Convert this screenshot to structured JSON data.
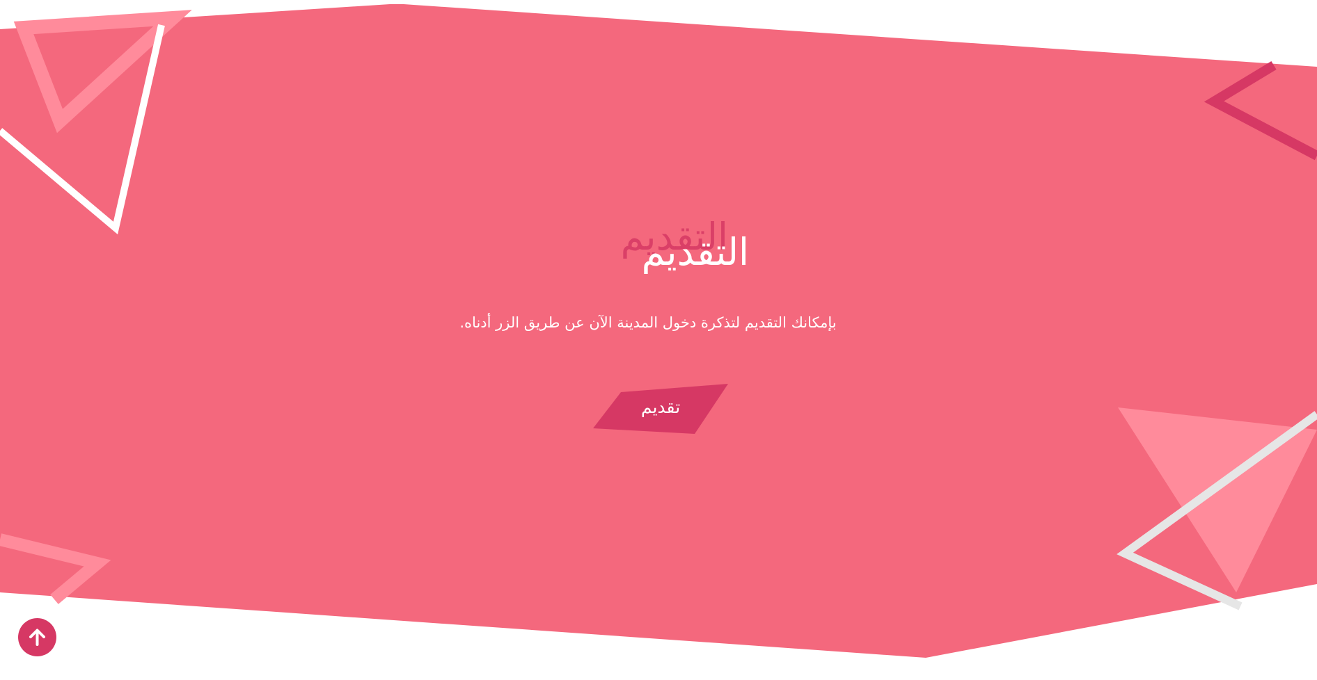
{
  "hero": {
    "title": "التقديم",
    "title_shadow": "التقديم",
    "description": "بإمكانك التقديم لتذكرة دخول المدينة الآن عن طريق الزر أدناه.",
    "cta_label": "تقديم"
  },
  "controls": {
    "scroll_top_icon": "arrow-up-icon"
  },
  "colors": {
    "background_panel": "#f4687d",
    "accent": "#d63864",
    "light_shape": "#ff8b9b",
    "white": "#ffffff"
  }
}
